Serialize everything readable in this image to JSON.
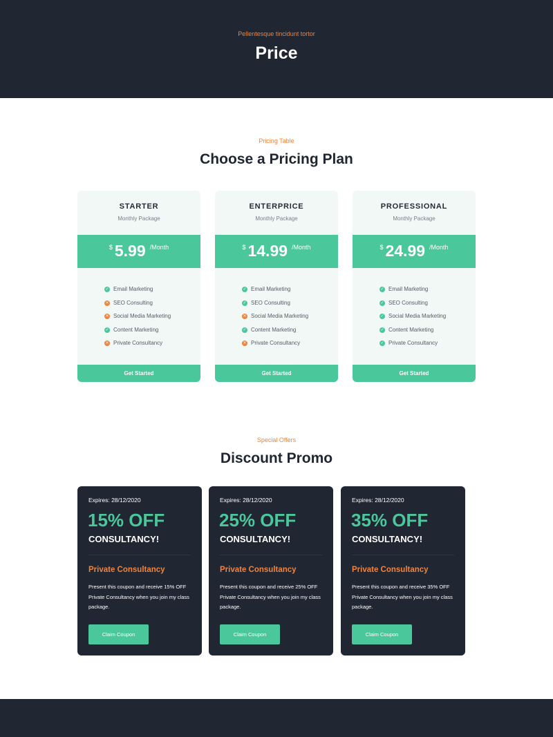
{
  "hero": {
    "eyebrow": "Pellentesque tincidunt tortor",
    "title": "Price"
  },
  "pricing": {
    "eyebrow": "Pricing Table",
    "title": "Choose a Pricing Plan",
    "plans": [
      {
        "name": "STARTER",
        "package": "Monthly Package",
        "currency": "$",
        "amount": "5.99",
        "period": "/Month",
        "features": [
          {
            "label": "Email Marketing",
            "included": true,
            "icon": "check-icon"
          },
          {
            "label": "SEO Consulting",
            "included": false,
            "icon": "cross-icon"
          },
          {
            "label": "Social Media Marketing",
            "included": false,
            "icon": "cross-icon"
          },
          {
            "label": "Content Marketing",
            "included": true,
            "icon": "check-icon"
          },
          {
            "label": "Private Consultancy",
            "included": false,
            "icon": "cross-icon"
          }
        ],
        "cta": "Get Started"
      },
      {
        "name": "ENTERPRICE",
        "package": "Monthly Package",
        "currency": "$",
        "amount": "14.99",
        "period": "/Month",
        "features": [
          {
            "label": "Email Marketing",
            "included": true,
            "icon": "check-icon"
          },
          {
            "label": "SEO Consulting",
            "included": true,
            "icon": "check-icon"
          },
          {
            "label": "Social Media Marketing",
            "included": false,
            "icon": "cross-icon"
          },
          {
            "label": "Content Marketing",
            "included": true,
            "icon": "check-icon"
          },
          {
            "label": "Private Consultancy",
            "included": false,
            "icon": "cross-icon"
          }
        ],
        "cta": "Get Started"
      },
      {
        "name": "PROFESSIONAL",
        "package": "Monthly Package",
        "currency": "$",
        "amount": "24.99",
        "period": "/Month",
        "features": [
          {
            "label": "Email Marketing",
            "included": true,
            "icon": "check-icon"
          },
          {
            "label": "SEO Consulting",
            "included": true,
            "icon": "check-icon"
          },
          {
            "label": "Social Media Marketing",
            "included": true,
            "icon": "check-icon"
          },
          {
            "label": "Content Marketing",
            "included": true,
            "icon": "check-icon"
          },
          {
            "label": "Private Consultancy",
            "included": true,
            "icon": "check-icon"
          }
        ],
        "cta": "Get Started"
      }
    ]
  },
  "promo": {
    "eyebrow": "Special Offers",
    "title": "Discount Promo",
    "coupons": [
      {
        "expires": "Expires: 28/12/2020",
        "discount": "15% OFF",
        "what": "CONSULTANCY!",
        "subtitle": "Private Consultancy",
        "description": "Present this coupon and receive 15% OFF Private Consultancy when you join my class package.",
        "button": "Claim Coupon"
      },
      {
        "expires": "Expires: 28/12/2020",
        "discount": "25% OFF",
        "what": "CONSULTANCY!",
        "subtitle": "Private Consultancy",
        "description": "Present this coupon and receive 25% OFF Private Consultancy when you join my class package.",
        "button": "Claim Coupon"
      },
      {
        "expires": "Expires: 28/12/2020",
        "discount": "35% OFF",
        "what": "CONSULTANCY!",
        "subtitle": "Private Consultancy",
        "description": "Present this coupon and receive 35% OFF Private Consultancy when you join my class package.",
        "button": "Claim Coupon"
      }
    ]
  },
  "colors": {
    "dark": "#202632",
    "accent_green": "#4bc89b",
    "accent_orange": "#f0843a",
    "card_bg": "#f2f8f6"
  }
}
